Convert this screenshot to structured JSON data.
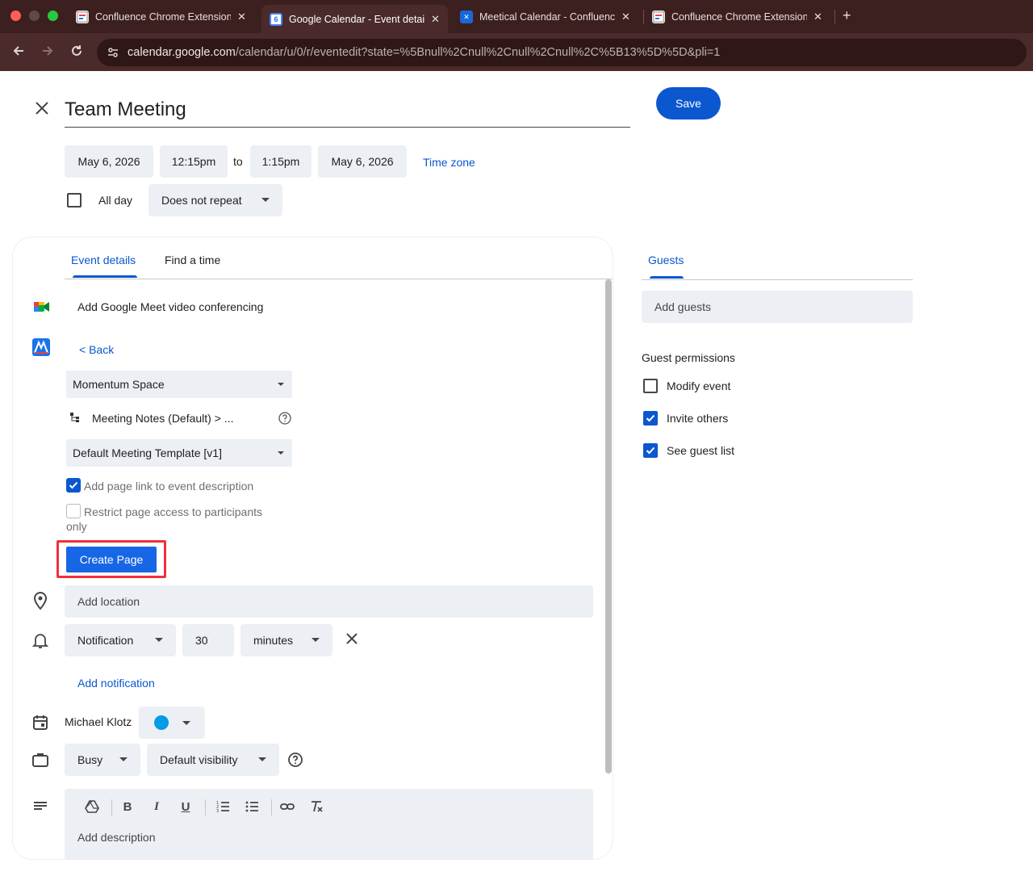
{
  "browser": {
    "tabs": [
      {
        "title": "Confluence Chrome Extension",
        "close": "✕"
      },
      {
        "title": "Google Calendar - Event details",
        "close": "✕",
        "favicon_text": "6"
      },
      {
        "title": "Meetical Calendar - Confluence",
        "close": "✕"
      },
      {
        "title": "Confluence Chrome Extension",
        "close": "✕"
      }
    ],
    "new_tab": "+",
    "url_host": "calendar.google.com",
    "url_path": "/calendar/u/0/r/eventedit?state=%5Bnull%2Cnull%2Cnull%2Cnull%2C%5B13%5D%5D&pli=1"
  },
  "event": {
    "title": "Team Meeting",
    "save_label": "Save",
    "start_date": "May 6, 2026",
    "start_time": "12:15pm",
    "to_label": "to",
    "end_time": "1:15pm",
    "end_date": "May 6, 2026",
    "time_zone_label": "Time zone",
    "all_day_label": "All day",
    "repeat_value": "Does not repeat"
  },
  "details": {
    "tabs": [
      "Event details",
      "Find a time"
    ],
    "meet_label": "Add Google Meet video conferencing",
    "meetical": {
      "back_label": "< Back",
      "space_value": "Momentum Space",
      "parent_label": "Meeting Notes (Default) > ...",
      "template_value": "Default Meeting Template [v1]",
      "add_link_label": "Add page link to event description",
      "restrict_label_1": "Restrict page access to participants",
      "restrict_label_2": "only",
      "create_label": "Create Page"
    },
    "location_placeholder": "Add location",
    "notification_type": "Notification",
    "notification_amount": "30",
    "notification_unit": "minutes",
    "add_notification_label": "Add notification",
    "owner_name": "Michael Klotz",
    "calendar_color": "#039be5",
    "availability_value": "Busy",
    "visibility_value": "Default visibility",
    "description_placeholder": "Add description"
  },
  "guests": {
    "tab_label": "Guests",
    "add_placeholder": "Add guests",
    "permissions_title": "Guest permissions",
    "permissions": [
      {
        "label": "Modify event",
        "checked": false
      },
      {
        "label": "Invite others",
        "checked": true
      },
      {
        "label": "See guest list",
        "checked": true
      }
    ]
  },
  "colors": {
    "primary": "#0b57d0",
    "highlight_border": "#f0303a",
    "chrome_bg": "#3c1f1f"
  }
}
